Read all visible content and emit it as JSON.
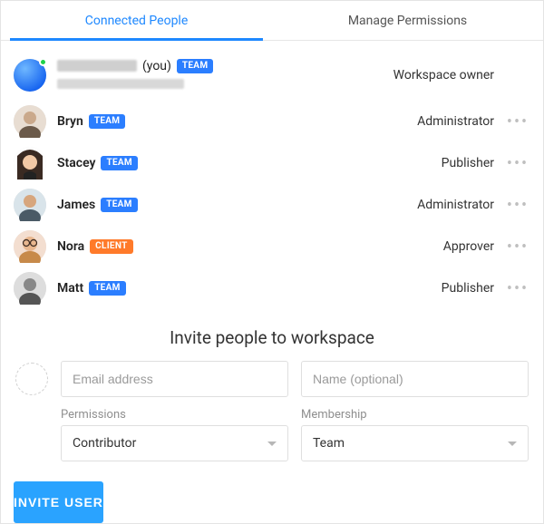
{
  "tabs": {
    "connected": "Connected People",
    "permissions": "Manage Permissions"
  },
  "people": [
    {
      "name_hidden": true,
      "you_suffix": "(you)",
      "email_hidden": true,
      "badge": "TEAM",
      "badge_kind": "team",
      "role": "Workspace owner",
      "presence": true,
      "has_menu": false,
      "avatar": "blue-gradient"
    },
    {
      "name": "Bryn",
      "badge": "TEAM",
      "badge_kind": "team",
      "role": "Administrator",
      "has_menu": true,
      "avatar": "photo1"
    },
    {
      "name": "Stacey",
      "badge": "TEAM",
      "badge_kind": "team",
      "role": "Publisher",
      "has_menu": true,
      "avatar": "photo2"
    },
    {
      "name": "James",
      "badge": "TEAM",
      "badge_kind": "team",
      "role": "Administrator",
      "has_menu": true,
      "avatar": "photo3"
    },
    {
      "name": "Nora",
      "badge": "CLIENT",
      "badge_kind": "client",
      "role": "Approver",
      "has_menu": true,
      "avatar": "photo4"
    },
    {
      "name": "Matt",
      "badge": "TEAM",
      "badge_kind": "team",
      "role": "Publisher",
      "has_menu": true,
      "avatar": "photo5"
    }
  ],
  "invite": {
    "title": "Invite people to workspace",
    "email_placeholder": "Email address",
    "name_placeholder": "Name (optional)",
    "permissions_label": "Permissions",
    "permissions_value": "Contributor",
    "membership_label": "Membership",
    "membership_value": "Team",
    "button": "INVITE USER"
  }
}
